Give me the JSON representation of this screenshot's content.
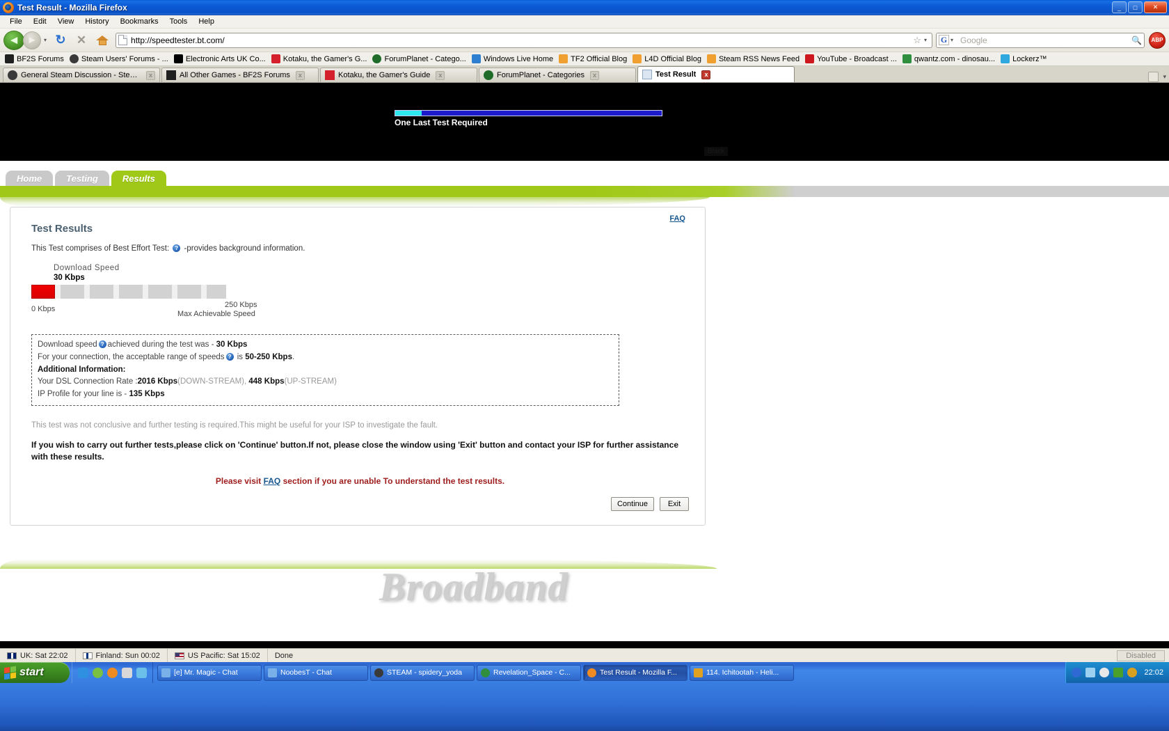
{
  "window": {
    "title": "Test Result - Mozilla Firefox",
    "minimize": "_",
    "maximize": "□",
    "close": "✕"
  },
  "menubar": [
    {
      "label": "File"
    },
    {
      "label": "Edit"
    },
    {
      "label": "View"
    },
    {
      "label": "History"
    },
    {
      "label": "Bookmarks"
    },
    {
      "label": "Tools"
    },
    {
      "label": "Help"
    }
  ],
  "toolbar": {
    "back_glyph": "◄",
    "forward_glyph": "►",
    "dropdown_glyph": "▾",
    "reload_glyph": "↻",
    "stop_glyph": "✕",
    "star_glyph": "☆",
    "url": "http://speedtester.bt.com/",
    "search_placeholder": "Google",
    "search_engine_letter": "G",
    "search_glyph": "🔍",
    "adblock_label": "ABP"
  },
  "bookmarks": [
    {
      "label": "BF2S Forums",
      "color": "#202020"
    },
    {
      "label": "Steam Users' Forums - ...",
      "color": "#3a3a3a"
    },
    {
      "label": "Electronic Arts UK Co...",
      "color": "#000000"
    },
    {
      "label": "Kotaku, the Gamer's G...",
      "color": "#d4202a"
    },
    {
      "label": "ForumPlanet - Catego...",
      "color": "#1f6b2a"
    },
    {
      "label": "Windows Live Home",
      "color": "#2f7fd0"
    },
    {
      "label": "TF2 Official Blog",
      "color": "#f0a030"
    },
    {
      "label": "L4D Official Blog",
      "color": "#f0a030"
    },
    {
      "label": "Steam RSS News Feed",
      "color": "#f0a030"
    },
    {
      "label": "YouTube - Broadcast ...",
      "color": "#cc181e"
    },
    {
      "label": "qwantz.com - dinosau...",
      "color": "#2f8f3f"
    },
    {
      "label": "Lockerz™",
      "color": "#2fa8e0"
    }
  ],
  "tabs": [
    {
      "label": "General Steam Discussion - Steam User...",
      "color": "#3a3a3a",
      "active": false,
      "close": "x"
    },
    {
      "label": "All Other Games - BF2S Forums",
      "color": "#202020",
      "active": false,
      "close": "x"
    },
    {
      "label": "Kotaku, the Gamer's Guide",
      "color": "#d4202a",
      "active": false,
      "close": "x"
    },
    {
      "label": "ForumPlanet - Categories",
      "color": "#1f6b2a",
      "active": false,
      "close": "x"
    },
    {
      "label": "Test Result",
      "color": "#dbe6f2",
      "active": true,
      "close": "x"
    }
  ],
  "flash_banner": {
    "progress_text": "One Last Test Required",
    "progress_percent": 10,
    "bar_track_color": "#1c1ccc",
    "bar_fill_color": "#2ee8f0",
    "context_label": "Black"
  },
  "site_nav": {
    "tabs": [
      {
        "label": "Home",
        "active": false
      },
      {
        "label": "Testing",
        "active": false
      },
      {
        "label": "Results",
        "active": true
      }
    ],
    "accent_color": "#9fc818"
  },
  "results": {
    "faq_link": "FAQ",
    "title": "Test Results",
    "comprises_prefix": "This Test comprises of Best Effort Test:",
    "comprises_suffix": "-provides background information.",
    "gauge": {
      "label": "Download  Speed",
      "value": "30 Kbps",
      "min_label": "0 Kbps",
      "max_label": "250 Kbps",
      "max_sublabel": "Max Achievable Speed",
      "fill_color": "#ef0000",
      "fill_percent": 12
    },
    "info_lines": [
      {
        "pre": "Download speed",
        "mid": "achieved during the test was - ",
        "bold": "30 Kbps",
        "post": "",
        "has_help": true,
        "strong": false
      },
      {
        "pre": "For your connection, the acceptable range of speeds",
        "mid": " is ",
        "bold": "50-250 Kbps",
        "post": ".",
        "has_help": true,
        "strong": false
      },
      {
        "pre": "Additional Information:",
        "mid": "",
        "bold": "",
        "post": "",
        "has_help": false,
        "strong": true
      },
      {
        "pre": "Your DSL Connection Rate :",
        "mid": "",
        "bold": "2016 Kbps",
        "post": "(DOWN-STREAM), ",
        "bold2": "448 Kbps",
        "post2": "(UP-STREAM)",
        "has_help": false,
        "strong": false
      },
      {
        "pre": "IP Profile for your line is - ",
        "mid": "",
        "bold": "135 Kbps",
        "post": "",
        "has_help": false,
        "strong": false
      }
    ],
    "conclusion": "This test was not conclusive and further testing is required.This might be useful for your ISP to investigate the fault.",
    "instruction": "If you wish to carry out further tests,please click on 'Continue' button.If not, please close the window using 'Exit' button and contact your ISP for further assistance with these results.",
    "faq_note_pre": "Please visit ",
    "faq_note_link": "FAQ",
    "faq_note_post": " section if you are unable To understand the test results.",
    "continue_button": "Continue",
    "exit_button": "Exit",
    "brand_word": "Broadband"
  },
  "statusbar": {
    "clocks": [
      {
        "label": "UK: Sat 22:02",
        "flag": "uk"
      },
      {
        "label": "Finland: Sun 00:02",
        "flag": "fi"
      },
      {
        "label": "US Pacific: Sat 15:02",
        "flag": "us"
      }
    ],
    "load_status": "Done",
    "right_box": "Disabled"
  },
  "taskbar": {
    "start_label": "start",
    "tasks": [
      {
        "label": "[e] Mr. Magic - Chat",
        "color": "#7ab0e8",
        "active": false
      },
      {
        "label": "NoobesT - Chat",
        "color": "#7ab0e8",
        "active": false
      },
      {
        "label": "STEAM - spidery_yoda",
        "color": "#3a3a3a",
        "active": false
      },
      {
        "label": "Revelation_Space - C...",
        "color": "#2f8f3f",
        "active": false
      },
      {
        "label": "Test Result - Mozilla F...",
        "color": "#ef8b20",
        "active": true
      },
      {
        "label": "114. Ichitootah - Heli...",
        "color": "#e0a020",
        "active": false
      }
    ],
    "clock": "22:02"
  }
}
